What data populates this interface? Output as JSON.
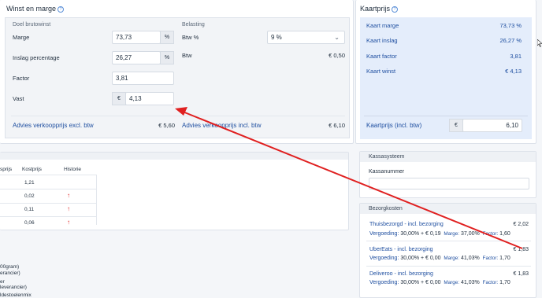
{
  "winst": {
    "title": "Winst en marge",
    "doel_heading": "Doel brutowinst",
    "marge_label": "Marge",
    "marge_value": "73,73",
    "marge_unit": "%",
    "inslag_label": "Inslag percentage",
    "inslag_value": "26,27",
    "inslag_unit": "%",
    "factor_label": "Factor",
    "factor_value": "3,81",
    "vast_label": "Vast",
    "vast_currency": "€",
    "vast_value": "4,13",
    "belasting_heading": "Belasting",
    "btw_pct_label": "Btw %",
    "btw_pct_value": "9 %",
    "btw_label": "Btw",
    "btw_value": "€ 0,50",
    "advies_excl_label": "Advies verkoopprijs excl. btw",
    "advies_excl_value": "€ 5,60",
    "advies_incl_label": "Advies verkoopprijs incl. btw",
    "advies_incl_value": "€ 6,10"
  },
  "kaartprijs": {
    "title": "Kaartprijs",
    "rows": [
      {
        "label": "Kaart marge",
        "value": "73,73 %"
      },
      {
        "label": "Kaart inslag",
        "value": "26,27 %"
      },
      {
        "label": "Kaart factor",
        "value": "3,81"
      },
      {
        "label": "Kaart winst",
        "value": "€ 4,13"
      }
    ],
    "incl_label": "Kaartprijs (incl. btw)",
    "incl_currency": "€",
    "incl_value": "6,10"
  },
  "table": {
    "col_partial": "sprijs",
    "col_kostprijs": "Kostprijs",
    "col_historie": "Historie",
    "rows": [
      {
        "kostprijs": "1,21",
        "trend": ""
      },
      {
        "kostprijs": "0,02",
        "trend": "↑"
      },
      {
        "kostprijs": "0,11",
        "trend": "↑"
      },
      {
        "kostprijs": "0,06",
        "trend": "↑"
      }
    ]
  },
  "left_snippets": [
    "00gram)",
    "erancier)",
    "er",
    "leverancier)",
    "ldestoelenmix"
  ],
  "kassa": {
    "title": "Kassasysteem",
    "nummer_label": "Kassanummer",
    "nummer_value": ""
  },
  "bezorg": {
    "title": "Bezorgkosten",
    "items": [
      {
        "name": "Thuisbezorgd - incl. bezorging",
        "price": "€ 2,02",
        "vergoeding_label": "Vergoeding:",
        "vergoeding": "30,00% + € 0,19",
        "marge_label": "Marge:",
        "marge": "37,00%",
        "factor_label": "Factor:",
        "factor": "1,60"
      },
      {
        "name": "UberEats - incl. bezorging",
        "price": "€ 1,83",
        "vergoeding_label": "Vergoeding:",
        "vergoeding": "30,00% + € 0,00",
        "marge_label": "Marge:",
        "marge": "41,03%",
        "factor_label": "Factor:",
        "factor": "1,70"
      },
      {
        "name": "Deliveroo - incl. bezorging",
        "price": "€ 1,83",
        "vergoeding_label": "Vergoeding:",
        "vergoeding": "30,00% + € 0,00",
        "marge_label": "Marge:",
        "marge": "41,03%",
        "factor_label": "Factor:",
        "factor": "1,70"
      }
    ]
  },
  "colors": {
    "accent": "#1f4fa0",
    "annotation_arrow": "#e02020",
    "blue_panel": "#e4edfb"
  }
}
